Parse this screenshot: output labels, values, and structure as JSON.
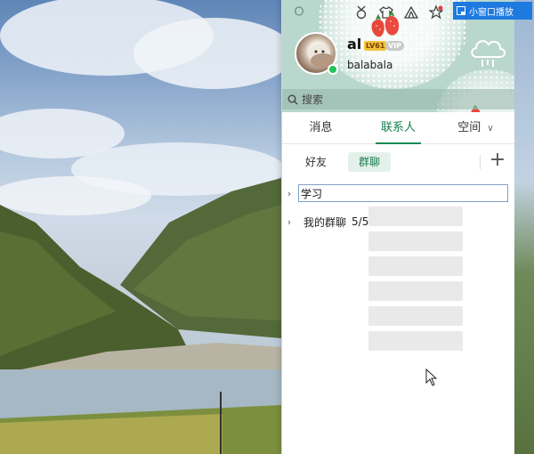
{
  "window": {
    "top_icons": [
      "sign-in-icon",
      "medal-icon",
      "shirt-icon",
      "tent-icon",
      "star-icon"
    ],
    "mini_mode_label": "小窗口播放"
  },
  "profile": {
    "nickname": "al",
    "level_badge": "LV61",
    "vip_badge": "VIP",
    "signature": "balabala",
    "status": "online",
    "accent_color": "#1a8a55"
  },
  "search": {
    "placeholder": "搜索"
  },
  "tabs": [
    {
      "label": "消息"
    },
    {
      "label": "联系人"
    },
    {
      "label": "空间"
    }
  ],
  "subtabs": [
    {
      "label": "好友"
    },
    {
      "label": "群聊"
    }
  ],
  "groups": [
    {
      "name_value": "学习",
      "editing": true
    },
    {
      "name": "我的群聊",
      "count": "5/5"
    }
  ]
}
